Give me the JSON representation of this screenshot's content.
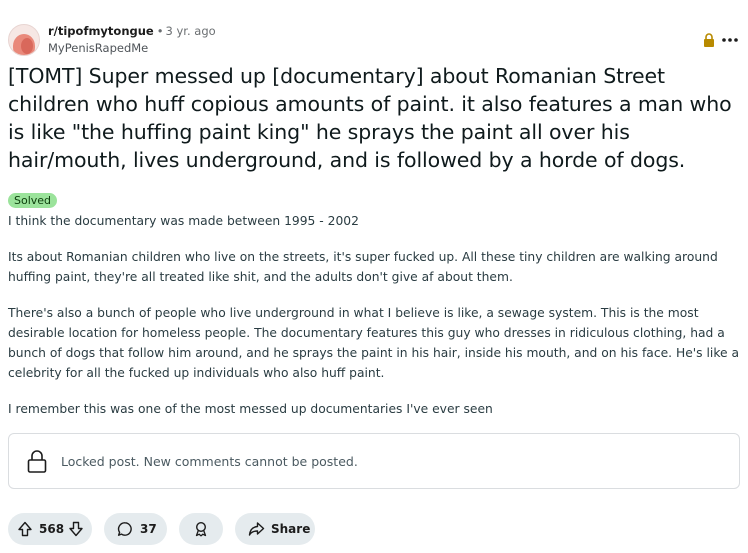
{
  "post": {
    "subreddit": "r/tipofmytongue",
    "separator": "•",
    "age": "3 yr. ago",
    "author": "MyPenisRapedMe",
    "title": "[TOMT] Super messed up [documentary] about Romanian Street children who huff copious amounts of paint. it also features a man who is like \"the huffing paint king\" he sprays the paint all over his hair/mouth, lives underground, and is followed by a horde of dogs.",
    "flair": "Solved",
    "paragraphs": [
      "I think the documentary was made between 1995 - 2002",
      "Its about Romanian children who live on the streets, it's super fucked up. All these tiny children are walking around huffing paint, they're all treated like shit, and the adults don't give af about them.",
      "There's also a bunch of people who live underground in what I believe is like, a sewage system. This is the most desirable location for homeless people. The documentary features this guy who dresses in ridiculous clothing, had a bunch of dogs that follow him around, and he sprays the paint in his hair, inside his mouth, and on his face. He's like a celebrity for all the fucked up individuals who also huff paint.",
      "I remember this was one of the most messed up documentaries I've ever seen"
    ],
    "locked_message": "Locked post. New comments cannot be posted.",
    "upvotes": "568",
    "comments": "37",
    "share_label": "Share"
  },
  "icons": {
    "lock": "lock-icon",
    "more": "more-options-icon",
    "upvote": "upvote-arrow-icon",
    "downvote": "downvote-arrow-icon",
    "comment": "comment-bubble-icon",
    "award": "award-icon",
    "share": "share-arrow-icon"
  },
  "colors": {
    "flair_bg": "#9be39b",
    "pill_bg": "#e5ebee",
    "lock_gold": "#b88a00"
  }
}
